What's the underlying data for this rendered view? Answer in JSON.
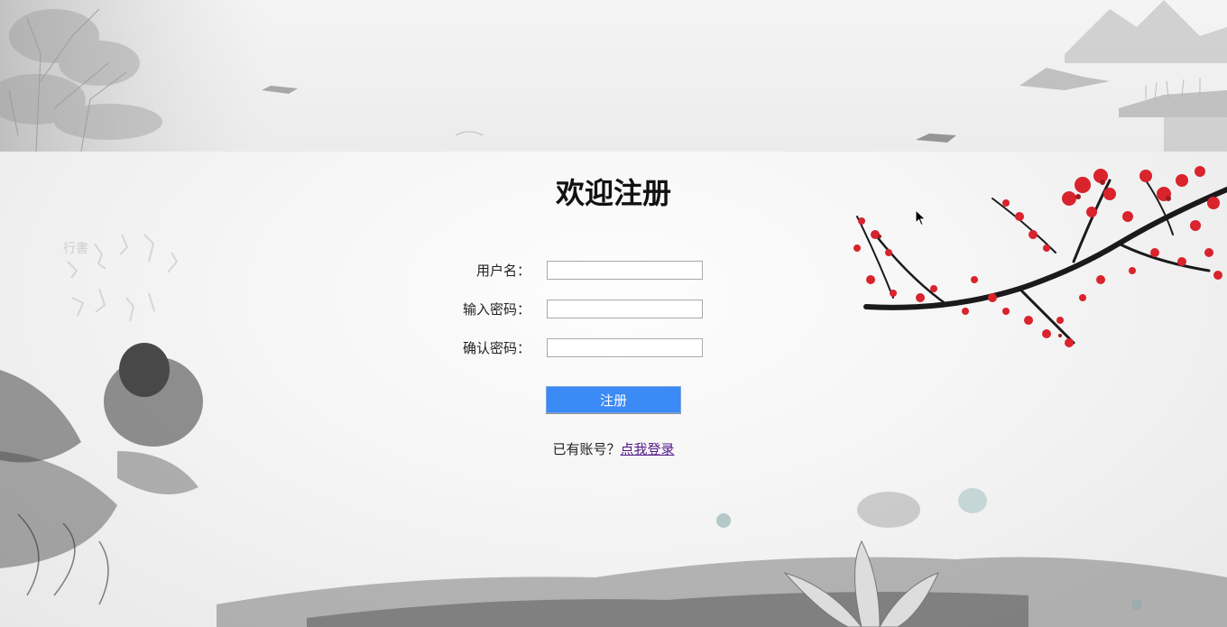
{
  "page": {
    "title": "欢迎注册"
  },
  "form": {
    "username_label": "用户名：",
    "username_value": "",
    "password_label": "输入密码：",
    "password_value": "",
    "confirm_label": "确认密码：",
    "confirm_value": "",
    "submit_label": "注册"
  },
  "login": {
    "prompt": "已有账号？",
    "link_text": "点我登录"
  },
  "theme": {
    "button_color": "#3b8af6",
    "link_color": "#551a8b",
    "blossom_color": "#d9232d"
  },
  "icons": [
    "mouse-pointer-icon"
  ]
}
